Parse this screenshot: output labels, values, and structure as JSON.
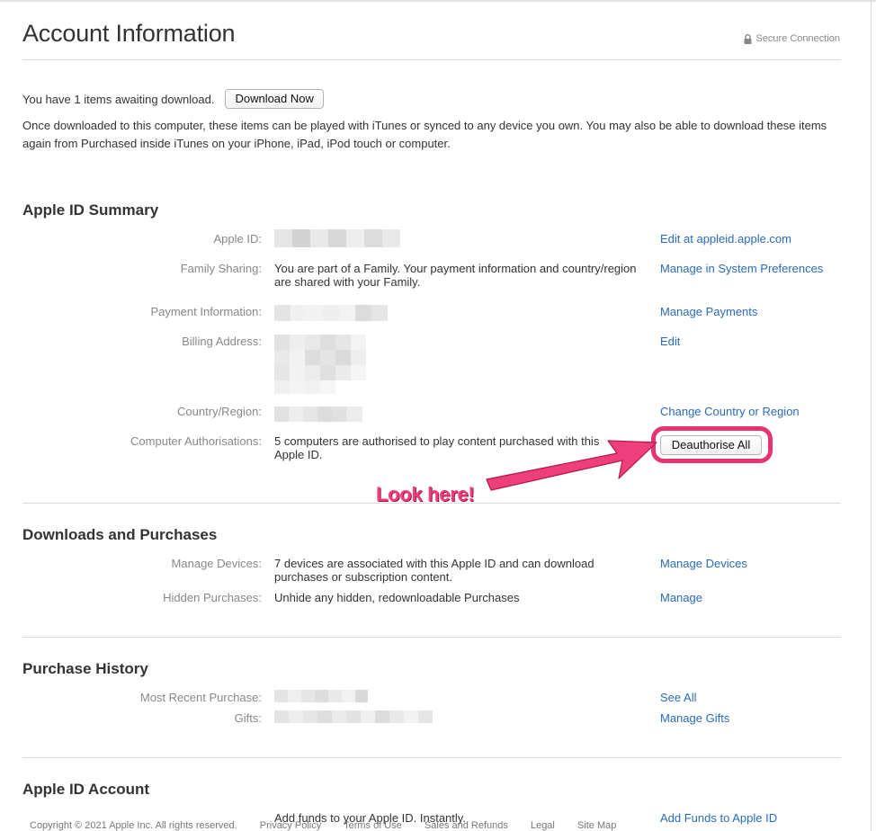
{
  "page": {
    "title": "Account Information",
    "secure_label": "Secure Connection"
  },
  "pending": {
    "text": "You have 1 items awaiting download.",
    "button": "Download Now",
    "description": "Once downloaded to this computer, these items can be played with iTunes or synced to any device you own. You may also be able to download these items again from Purchased inside iTunes on your iPhone, iPad, iPod touch or computer."
  },
  "summary": {
    "heading": "Apple ID Summary",
    "rows": [
      {
        "label": "Apple ID:",
        "value": "",
        "link": "Edit at appleid.apple.com"
      },
      {
        "label": "Family Sharing:",
        "value": "You are part of a Family. Your payment information and country/region are shared with your Family.",
        "link": "Manage in System Preferences"
      },
      {
        "label": "Payment Information:",
        "value": "",
        "link": "Manage Payments"
      },
      {
        "label": "Billing Address:",
        "value": "",
        "link": "Edit"
      },
      {
        "label": "Country/Region:",
        "value": "",
        "link": "Change Country or Region"
      },
      {
        "label": "Computer Authorisations:",
        "value": "5 computers are authorised to play content purchased with this Apple ID.",
        "button": "Deauthorise All"
      }
    ]
  },
  "downloads": {
    "heading": "Downloads and Purchases",
    "rows": [
      {
        "label": "Manage Devices:",
        "value": "7 devices are associated with this Apple ID and can download purchases or subscription content.",
        "link": "Manage Devices"
      },
      {
        "label": "Hidden Purchases:",
        "value": "Unhide any hidden, redownloadable Purchases",
        "link": "Manage"
      }
    ]
  },
  "history": {
    "heading": "Purchase History",
    "rows": [
      {
        "label": "Most Recent Purchase:",
        "value": "",
        "link": "See All"
      },
      {
        "label": "Gifts:",
        "value": "",
        "link": "Manage Gifts"
      }
    ]
  },
  "account": {
    "heading": "Apple ID Account",
    "rows": [
      {
        "label": "",
        "value": "Add funds to your Apple ID. Instantly.",
        "link": "Add Funds to Apple ID"
      }
    ]
  },
  "footer": {
    "copyright": "Copyright © 2021 Apple Inc. All rights reserved.",
    "links": [
      "Privacy Policy",
      "Terms of Use",
      "Sales and Refunds",
      "Legal",
      "Site Map"
    ]
  },
  "annotation": {
    "text": "Look here!",
    "color": "#e8336f"
  },
  "colors": {
    "link": "#2a6bb7",
    "label": "#888888",
    "text": "#333333",
    "rule": "#dcdcdc"
  }
}
